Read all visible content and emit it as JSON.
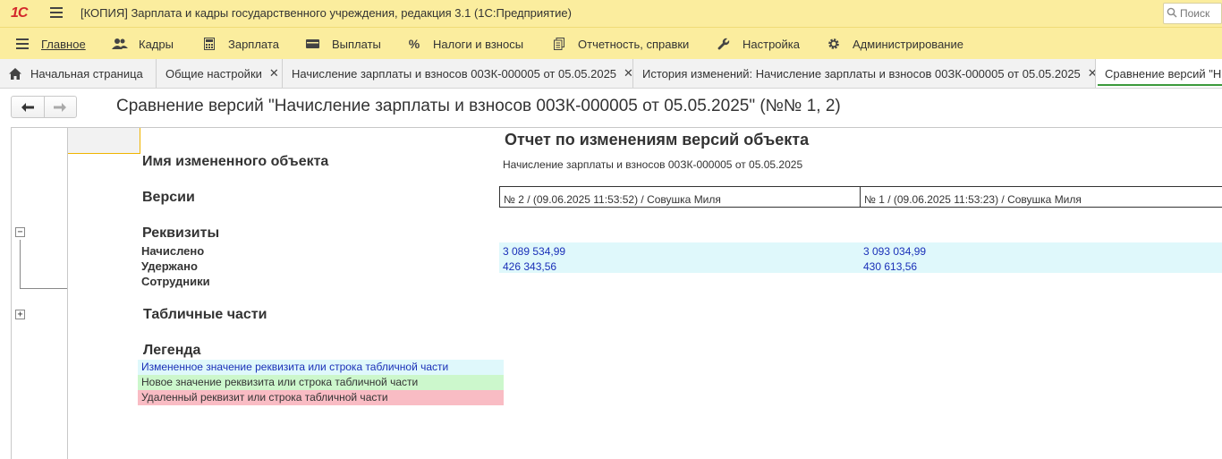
{
  "titlebar": {
    "logo": "1С",
    "title": "[КОПИЯ] Зарплата и кадры государственного учреждения, редакция 3.1  (1С:Предприятие)",
    "search_placeholder": "Поиск"
  },
  "menu": {
    "items": [
      {
        "label": "Главное",
        "icon": "hamburger-icon"
      },
      {
        "label": "Кадры",
        "icon": "people-icon"
      },
      {
        "label": "Зарплата",
        "icon": "calculator-icon"
      },
      {
        "label": "Выплаты",
        "icon": "wallet-icon"
      },
      {
        "label": "Налоги и взносы",
        "icon": "percent-icon"
      },
      {
        "label": "Отчетность, справки",
        "icon": "documents-icon"
      },
      {
        "label": "Настройка",
        "icon": "wrench-icon"
      },
      {
        "label": "Администрирование",
        "icon": "gear-icon"
      }
    ]
  },
  "tabs": [
    {
      "label": "Начальная страница",
      "icon": "home-icon"
    },
    {
      "label": "Общие настройки"
    },
    {
      "label": "Начисление зарплаты и взносов 00ЗК-000005 от 05.05.2025"
    },
    {
      "label": "История изменений: Начисление зарплаты и взносов 00ЗК-000005 от 05.05.2025"
    },
    {
      "label": "Сравнение версий \"Н"
    }
  ],
  "page": {
    "title": "Сравнение версий \"Начисление зарплаты и взносов 00ЗК-000005 от 05.05.2025\" (№№ 1, 2)"
  },
  "report": {
    "title": "Отчет по изменениям версий объекта",
    "object_label": "Имя измененного объекта",
    "object_value": "Начисление зарплаты и взносов 00ЗК-000005 от 05.05.2025",
    "versions_label": "Версии",
    "versions": [
      "№ 2 / (09.06.2025 11:53:52) / Совушка Миля",
      "№ 1 / (09.06.2025 11:53:23) / Совушка Миля"
    ],
    "attributes_label": "Реквизиты",
    "attributes": [
      {
        "name": "Начислено",
        "v2": "3 089 534,99",
        "v1": "3 093 034,99"
      },
      {
        "name": "Удержано",
        "v2": "426 343,56",
        "v1": "430 613,56"
      },
      {
        "name": "Сотрудники"
      }
    ],
    "tabular_label": "Табличные части",
    "legend_label": "Легенда",
    "legend": {
      "changed": "Измененное значение реквизита или строка табличной части",
      "added": "Новое значение реквизита или строка табличной части",
      "deleted": "Удаленный реквизит или строка табличной части"
    },
    "colors": {
      "changed": "#dff8fb",
      "added": "#ccf7cc",
      "deleted": "#f9bcc4",
      "changed_text": "#1a30b8"
    }
  }
}
